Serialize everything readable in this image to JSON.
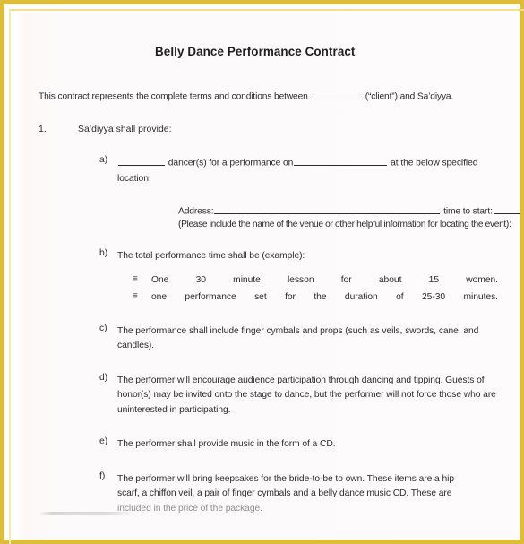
{
  "document": {
    "title": "Belly Dance Performance Contract",
    "intro": {
      "before_blank": "This contract represents the complete terms and conditions between",
      "after_blank": "(“client”) and Sa’diyya."
    },
    "clause": {
      "number": "1.",
      "text": "Sa’diyya shall provide:"
    },
    "items": [
      {
        "marker": "a)",
        "text_part1": "dancer(s) for a performance on",
        "text_part2": "at the below specified",
        "text_part3": "location:"
      },
      {
        "marker": "b)",
        "text": "The total performance time shall be (example):",
        "sub_marker": "≡",
        "sub_items": [
          "One 30 minute lesson for about 15 women.",
          "one performance set for the duration of 25-30 minutes."
        ]
      },
      {
        "marker": "c)",
        "text": "The performance shall include finger cymbals and props (such as veils, swords, cane, and candles)."
      },
      {
        "marker": "d)",
        "text": "The performer will encourage audience participation through dancing and tipping. Guests of honor(s) may be invited onto the stage to dance, but the performer will not force those who are uninterested in participating."
      },
      {
        "marker": "e)",
        "text": "The performer shall provide music in the form of a CD."
      },
      {
        "marker": "f)",
        "text_line1": "The performer will bring keepsakes for the bride-to-be to own.  These items are a hip",
        "text_line2": "scarf, a chiffon veil, a pair of finger cymbals and a belly dance music CD.  These are",
        "text_line3": "included in the price of the package."
      }
    ],
    "address_block": {
      "label_address": "Address:",
      "label_time": "time to start:",
      "note": "(Please include the name of the venue or other helpful information for locating the event):"
    }
  },
  "colors": {
    "frame": "#dcbe3c",
    "page": "#fdfafa",
    "text": "#2b2b2b"
  }
}
